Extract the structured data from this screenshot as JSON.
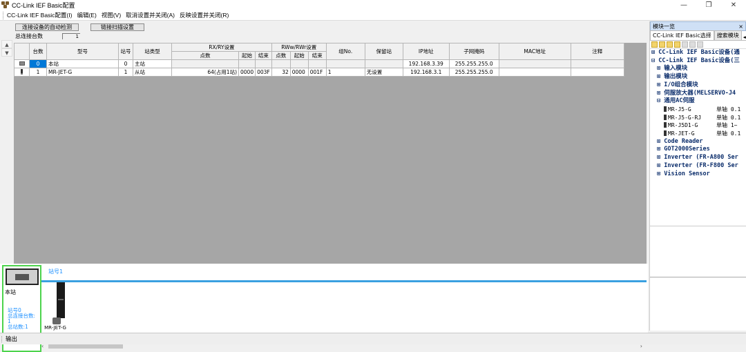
{
  "window": {
    "title": "CC-Link IEF Basic配置",
    "minimize": "—",
    "maximize": "❐",
    "close": "✕"
  },
  "menu": [
    "CC-Link IEF Basic配置(I)",
    "编辑(E)",
    "视图(V)",
    "取消设置并关闭(A)",
    "反映设置并关闭(R)"
  ],
  "toolbar": {
    "autodetect_label": "连接设备的自动检测",
    "linkscan_label": "链接扫描设置",
    "total_label": "总连接台数",
    "total_value": "1"
  },
  "grid": {
    "headers": {
      "count": "台数",
      "model": "型号",
      "station_no": "站号",
      "station_type": "站类型",
      "rxry_group": "RX/RY设置",
      "points": "点数",
      "start": "起始",
      "end": "结束",
      "rwwrwr_group": "RWw/RWr设置",
      "group_no": "组No.",
      "reserved": "保留站",
      "ip": "IP地址",
      "subnet": "子网掩码",
      "mac": "MAC地址",
      "note": "注释"
    },
    "rows": [
      {
        "count": "0",
        "model": "本站",
        "station_no": "0",
        "station_type": "主站",
        "rx_points": "",
        "rx_start": "",
        "rx_end": "",
        "rw_points": "",
        "rw_start": "",
        "rw_end": "",
        "group": "",
        "reserved": "",
        "ip": "192.168.3.39",
        "subnet": "255.255.255.0",
        "mac": "",
        "note": ""
      },
      {
        "count": "1",
        "model": "MR-JET-G",
        "station_no": "1",
        "station_type": "从站",
        "rx_points": "64(占用1站)",
        "rx_start": "0000",
        "rx_end": "003F",
        "rw_points": "32",
        "rw_start": "0000",
        "rw_end": "001F",
        "group": "1",
        "reserved": "无设置",
        "ip": "192.168.3.1",
        "subnet": "255.255.255.0",
        "mac": "",
        "note": ""
      }
    ]
  },
  "topology": {
    "host_label": "本站",
    "host_info_station": "站号0",
    "host_info_total": "总连接台数:",
    "host_info_total_value": "1",
    "host_info_stations": "总站数:1",
    "station_label": "站号1",
    "device_label": "MR-JET-G"
  },
  "right_panel": {
    "title": "模块一览",
    "close": "×",
    "tab1": "CC-Link IEF Basic选择",
    "tab2": "搜索模块",
    "tree": [
      {
        "label": "CC-Link IEF Basic设备(通",
        "level": 1
      },
      {
        "label": "CC-Link IEF Basic设备(三",
        "level": 1,
        "expanded": true
      },
      {
        "label": "输入模块",
        "level": 2
      },
      {
        "label": "输出模块",
        "level": 2
      },
      {
        "label": "I/O组合模块",
        "level": 2
      },
      {
        "label": "伺服放大器(MELSERVO-J4",
        "level": 2
      },
      {
        "label": "通用AC伺服",
        "level": 2,
        "expanded": true
      },
      {
        "label": "MR-J5-G",
        "desc": "单轴 0.1",
        "level": 3
      },
      {
        "label": "MR-J5-G-RJ",
        "desc": "单轴 0.1",
        "level": 3
      },
      {
        "label": "MR-J5D1-G",
        "desc": "单轴 1~",
        "level": 3
      },
      {
        "label": "MR-JET-G",
        "desc": "单轴 0.1",
        "level": 3
      },
      {
        "label": "Code Reader",
        "level": 2
      },
      {
        "label": "GOT2000Series",
        "level": 2
      },
      {
        "label": "Inverter (FR-A800 Ser",
        "level": 2
      },
      {
        "label": "Inverter (FR-F800 Ser",
        "level": 2
      },
      {
        "label": "Vision Sensor",
        "level": 2
      }
    ]
  },
  "output": {
    "label": "输出"
  },
  "colors": {
    "selected": "#0078d7",
    "bus": "#3aa0e0",
    "host_border": "#4cd34c",
    "gray_area": "#a6a6a6"
  }
}
